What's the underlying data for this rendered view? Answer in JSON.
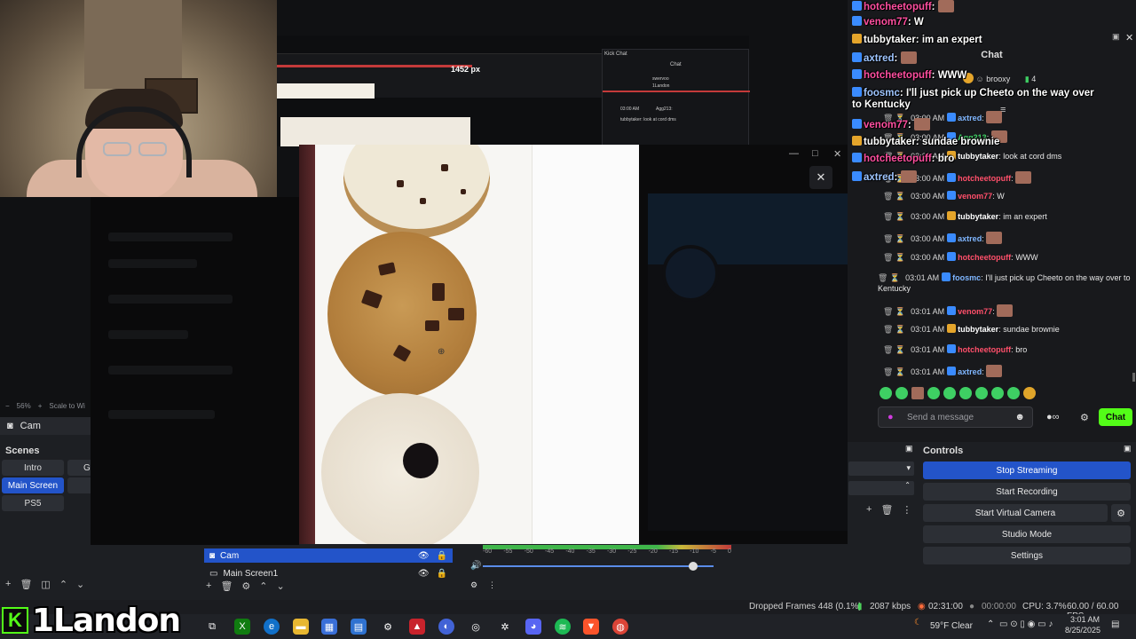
{
  "obs": {
    "zoom_label": "56%",
    "scale_label": "Scale to Wi",
    "cam_title": "Cam",
    "scenes": {
      "title": "Scenes",
      "items": [
        "Intro",
        "Main Screen",
        "PS5"
      ],
      "extra_item": "G"
    },
    "sources": {
      "items": [
        "Cam",
        "Main Screen1"
      ]
    },
    "mixer_ticks": [
      "-60",
      "-55",
      "-50",
      "-45",
      "-40",
      "-35",
      "-30",
      "-25",
      "-20",
      "-15",
      "-10",
      "-5",
      "0"
    ],
    "controls": {
      "title": "Controls",
      "buttons": [
        "Stop Streaming",
        "Start Recording",
        "Start Virtual Camera",
        "Studio Mode",
        "Settings"
      ]
    },
    "status": {
      "dropped_frames": "Dropped Frames 448 (0.1%)",
      "bitrate": "2087 kbps",
      "stream_time": "02:31:00",
      "rec_time": "00:00:00",
      "cpu": "CPU: 3.7%",
      "fps": "60.00 / 60.00 FPS"
    }
  },
  "nested": {
    "kick_chat_title": "Kick Chat",
    "chat_label": "Chat",
    "px_label": "1452 px",
    "rows": [
      "swervoo",
      "1Landon",
      "03:00 AM",
      "Agg213:",
      "tubbytaker: look at cord dms"
    ]
  },
  "chat": {
    "header": "Chat",
    "top_user": "brooxy",
    "top_count": "4",
    "rows": [
      {
        "time": "03:00 AM",
        "user": "axtred",
        "text": "",
        "color": "#7fb6ff",
        "emote": true
      },
      {
        "time": "03:00 AM",
        "user": "Agg213",
        "text": "",
        "color": "#3ecf63",
        "emote": true
      },
      {
        "time": "03:00 AM",
        "user": "tubbytaker",
        "text": "look at cord dms",
        "color": "#ffffff",
        "emote": false
      },
      {
        "time": "03:00 AM",
        "user": "hotcheetopuff",
        "text": "",
        "color": "#ff4f6a",
        "emote": true
      },
      {
        "time": "03:00 AM",
        "user": "venom77",
        "text": "W",
        "color": "#ff4f6a",
        "emote": false
      },
      {
        "time": "03:00 AM",
        "user": "tubbytaker",
        "text": "im an expert",
        "color": "#ffffff",
        "emote": false
      },
      {
        "time": "03:00 AM",
        "user": "axtred",
        "text": "",
        "color": "#7fb6ff",
        "emote": true
      },
      {
        "time": "03:00 AM",
        "user": "hotcheetopuff",
        "text": "WWW",
        "color": "#ff4f6a",
        "emote": false
      },
      {
        "time": "03:01 AM",
        "user": "foosmc",
        "text": "I'll just pick up Cheeto on the way over to Kentucky",
        "color": "#7fb6ff",
        "emote": false
      },
      {
        "time": "03:01 AM",
        "user": "venom77",
        "text": "",
        "color": "#ff4f6a",
        "emote": true
      },
      {
        "time": "03:01 AM",
        "user": "tubbytaker",
        "text": "sundae brownie",
        "color": "#ffffff",
        "emote": false
      },
      {
        "time": "03:01 AM",
        "user": "hotcheetopuff",
        "text": "bro",
        "color": "#ff4f6a",
        "emote": false
      },
      {
        "time": "03:01 AM",
        "user": "axtred",
        "text": "",
        "color": "#7fb6ff",
        "emote": true
      }
    ],
    "input_placeholder": "Send a message",
    "send_label": "Chat"
  },
  "overlay": [
    {
      "user": "hotcheetopuff",
      "text": "",
      "style": "pink"
    },
    {
      "user": "venom77",
      "text": "W",
      "style": "pink"
    },
    {
      "user": "tubbytaker",
      "text": "im an expert",
      "style": "white"
    },
    {
      "user": "axtred",
      "text": "",
      "style": "blue"
    },
    {
      "user": "hotcheetopuff",
      "text": "WWW",
      "style": "pink"
    },
    {
      "user": "foosmc",
      "text": "I'll just pick up Cheeto on the way over",
      "style": "blue"
    },
    {
      "user": "",
      "text": "to Kentucky",
      "style": "white"
    },
    {
      "user": "venom77",
      "text": "",
      "style": "pink"
    },
    {
      "user": "tubbytaker",
      "text": "sundae brownie",
      "style": "white"
    },
    {
      "user": "hotcheetopuff",
      "text": "bro",
      "style": "pink"
    },
    {
      "user": "axtred",
      "text": "",
      "style": "blue"
    }
  ],
  "taskbar": {
    "weather": "59°F  Clear",
    "time": "3:01 AM",
    "date": "8/25/2025"
  },
  "branding": {
    "channel_name": "1Landon",
    "logo_letter": "K"
  }
}
